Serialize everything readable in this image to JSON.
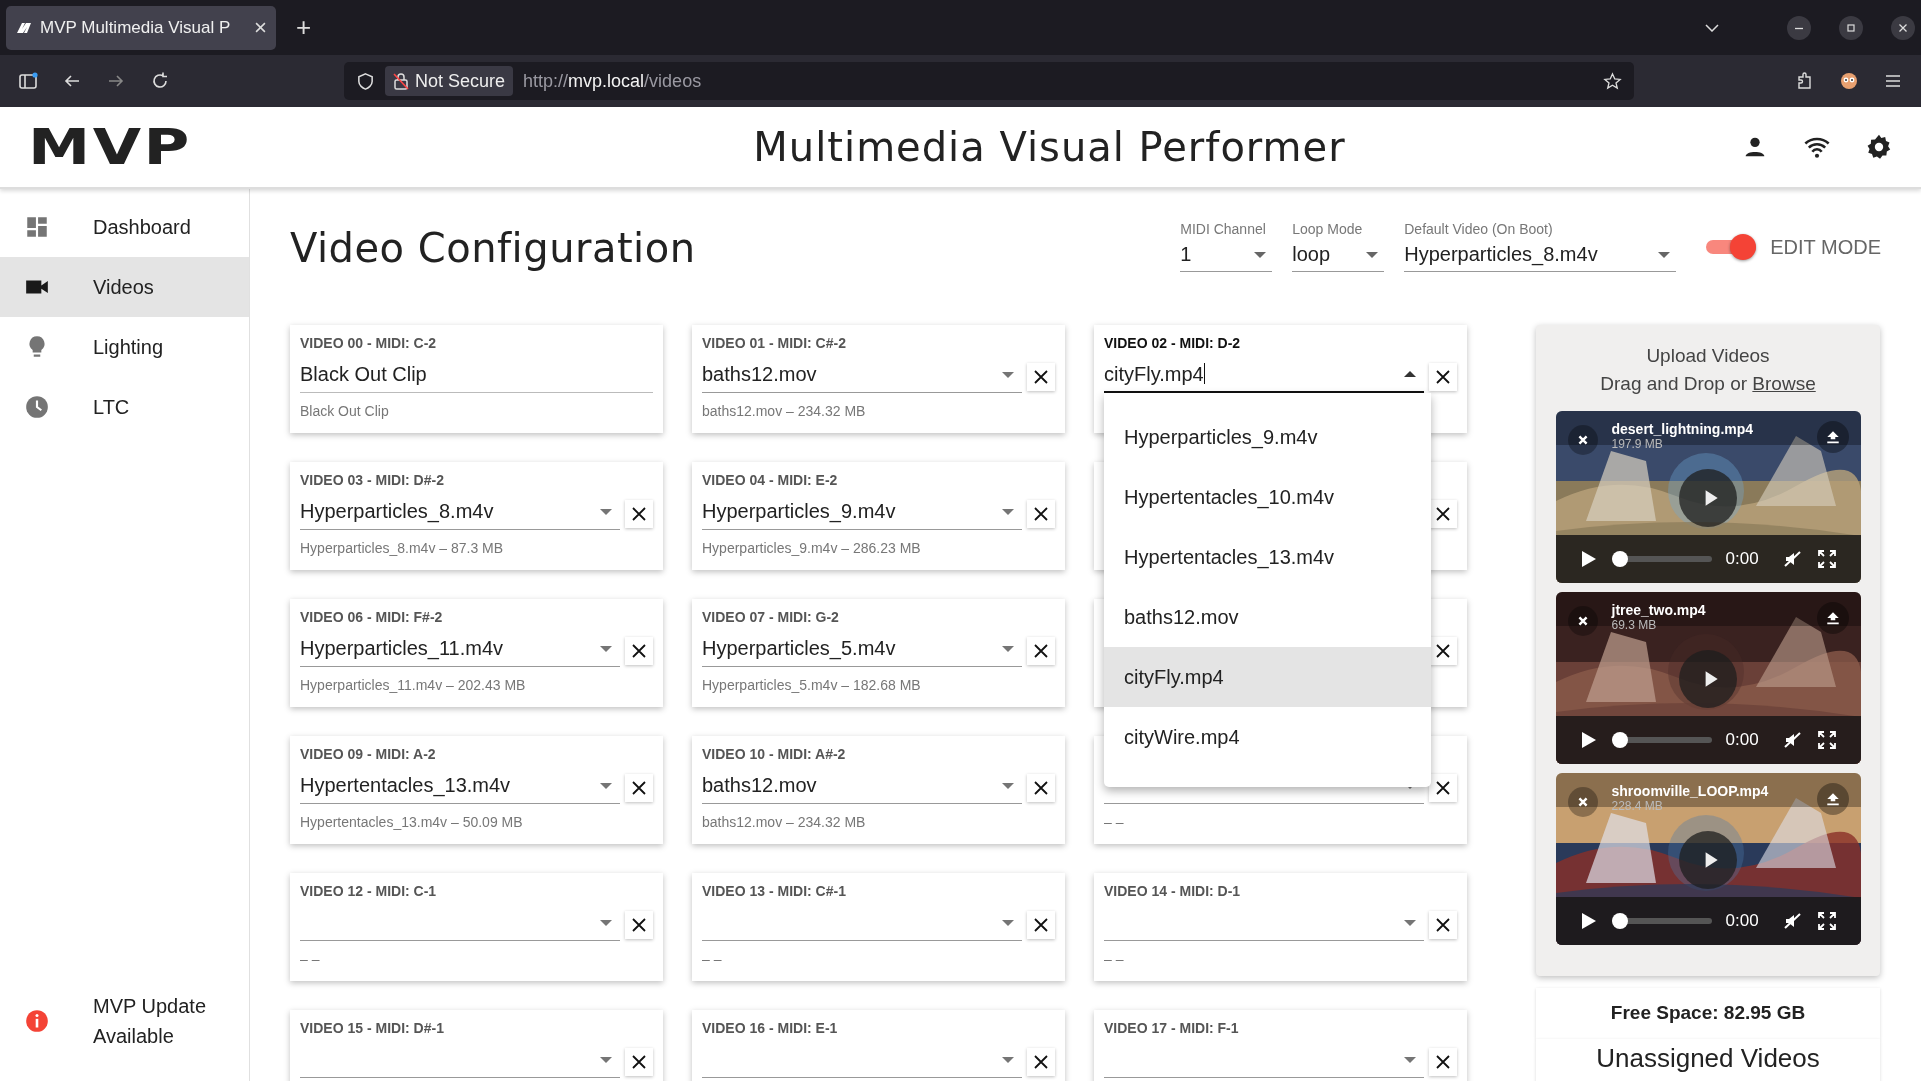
{
  "browser": {
    "tab_title": "MVP Multimedia Visual P",
    "new_tab": "+",
    "security": "Not Secure",
    "url": {
      "scheme": "http://",
      "host": "mvp.local",
      "path": "/videos"
    }
  },
  "header": {
    "logo": "MVP",
    "title": "Multimedia Visual Performer"
  },
  "sidebar": {
    "items": [
      {
        "label": "Dashboard",
        "selected": false
      },
      {
        "label": "Videos",
        "selected": true
      },
      {
        "label": "Lighting",
        "selected": false
      },
      {
        "label": "LTC",
        "selected": false
      }
    ],
    "footer": "MVP Update Available"
  },
  "page": {
    "title": "Video Configuration",
    "controls": [
      {
        "label": "MIDI Channel",
        "value": "1"
      },
      {
        "label": "Loop Mode",
        "value": "loop"
      },
      {
        "label": "Default Video (On Boot)",
        "value": "Hyperparticles_8.m4v"
      }
    ],
    "edit_mode": {
      "label": "EDIT MODE",
      "on": true
    }
  },
  "cards": [
    {
      "kind": "fixed",
      "title": "VIDEO 00 - MIDI: C-2",
      "value": "Black Out Clip",
      "helper": "Black Out Clip"
    },
    {
      "kind": "select",
      "title": "VIDEO 01 - MIDI: C#-2",
      "value": "baths12.mov",
      "helper": "baths12.mov – 234.32 MB"
    },
    {
      "kind": "open",
      "title": "VIDEO 02 - MIDI: D-2",
      "value": "cityFly.mp4",
      "options": [
        {
          "label": "Hyperparticles_9.m4v",
          "selected": false
        },
        {
          "label": "Hypertentacles_10.m4v",
          "selected": false
        },
        {
          "label": "Hypertentacles_13.m4v",
          "selected": false
        },
        {
          "label": "baths12.mov",
          "selected": false
        },
        {
          "label": "cityFly.mp4",
          "selected": true
        },
        {
          "label": "cityWire.mp4",
          "selected": false
        }
      ]
    },
    {
      "kind": "select",
      "title": "VIDEO 03 - MIDI: D#-2",
      "value": "Hyperparticles_8.m4v",
      "helper": "Hyperparticles_8.m4v – 87.3 MB"
    },
    {
      "kind": "select",
      "title": "VIDEO 04 - MIDI: E-2",
      "value": "Hyperparticles_9.m4v",
      "helper": "Hyperparticles_9.m4v – 286.23 MB"
    },
    {
      "kind": "covered"
    },
    {
      "kind": "select",
      "title": "VIDEO 06 - MIDI: F#-2",
      "value": "Hyperparticles_11.m4v",
      "helper": "Hyperparticles_11.m4v – 202.43 MB"
    },
    {
      "kind": "select",
      "title": "VIDEO 07 - MIDI: G-2",
      "value": "Hyperparticles_5.m4v",
      "helper": "Hyperparticles_5.m4v – 182.68 MB"
    },
    {
      "kind": "covered"
    },
    {
      "kind": "select",
      "title": "VIDEO 09 - MIDI: A-2",
      "value": "Hypertentacles_13.m4v",
      "helper": "Hypertentacles_13.m4v – 50.09 MB"
    },
    {
      "kind": "select",
      "title": "VIDEO 10 - MIDI: A#-2",
      "value": "baths12.mov",
      "helper": "baths12.mov – 234.32 MB"
    },
    {
      "kind": "select",
      "helper": "– –"
    },
    {
      "kind": "select",
      "title": "VIDEO 12 - MIDI: C-1",
      "helper": "– –"
    },
    {
      "kind": "select",
      "title": "VIDEO 13 - MIDI: C#-1",
      "helper": "– –"
    },
    {
      "kind": "select",
      "title": "VIDEO 14 - MIDI: D-1",
      "helper": "– –"
    },
    {
      "kind": "select",
      "title": "VIDEO 15 - MIDI: D#-1"
    },
    {
      "kind": "select",
      "title": "VIDEO 16 - MIDI: E-1"
    },
    {
      "kind": "select",
      "title": "VIDEO 17 - MIDI: F-1"
    }
  ],
  "upload": {
    "title": "Upload Videos",
    "hint": "Drag and Drop or",
    "link": "Browse",
    "videos": [
      {
        "name": "desert_lightning.mp4",
        "size": "197.9 MB",
        "time": "0:00",
        "level": 0
      },
      {
        "name": "jtree_two.mp4",
        "size": "69.3 MB",
        "time": "0:00",
        "level": 0
      },
      {
        "name": "shroomville_LOOP.mp4",
        "size": "228.4 MB",
        "time": "0:00",
        "level": 0
      }
    ],
    "free_space": "Free Space: 82.95 GB",
    "unassigned_title": "Unassigned Videos"
  }
}
